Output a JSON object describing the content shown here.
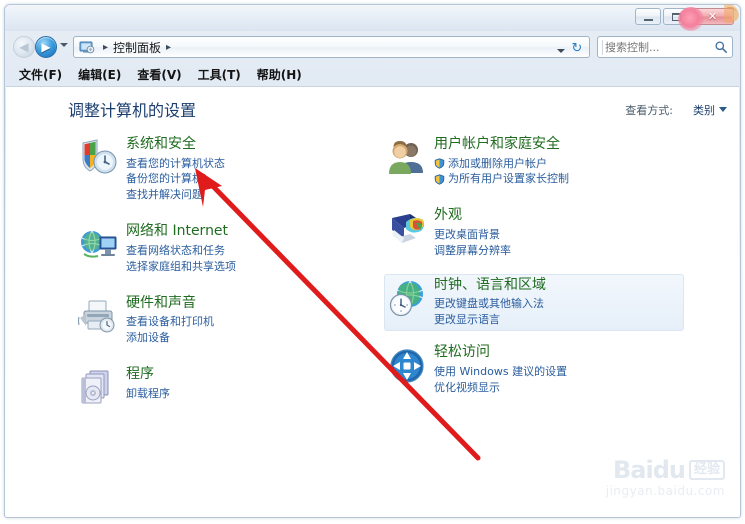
{
  "window": {
    "buttons": {
      "minimize": "–",
      "maximize": "□",
      "close": "✕"
    }
  },
  "addressbar": {
    "back_arrow": "◀",
    "forward_arrow": "▶",
    "breadcrumb_sep_1": "▸",
    "breadcrumb_root": "控制面板",
    "breadcrumb_sep_2": "▸",
    "refresh_glyph": "↻"
  },
  "search": {
    "placeholder": "搜索控制..."
  },
  "menubar": {
    "items": [
      {
        "label": "文件(F)"
      },
      {
        "label": "编辑(E)"
      },
      {
        "label": "查看(V)"
      },
      {
        "label": "工具(T)"
      },
      {
        "label": "帮助(H)"
      }
    ]
  },
  "page": {
    "title": "调整计算机的设置",
    "viewby_label": "查看方式:",
    "viewby_value": "类别"
  },
  "categories": {
    "left": [
      {
        "icon": "system-security-icon",
        "title": "系统和安全",
        "links": [
          {
            "text": "查看您的计算机状态",
            "shield": false
          },
          {
            "text": "备份您的计算机",
            "shield": false
          },
          {
            "text": "查找并解决问题",
            "shield": false
          }
        ]
      },
      {
        "icon": "network-internet-icon",
        "title": "网络和 Internet",
        "links": [
          {
            "text": "查看网络状态和任务",
            "shield": false
          },
          {
            "text": "选择家庭组和共享选项",
            "shield": false
          }
        ]
      },
      {
        "icon": "hardware-sound-icon",
        "title": "硬件和声音",
        "links": [
          {
            "text": "查看设备和打印机",
            "shield": false
          },
          {
            "text": "添加设备",
            "shield": false
          }
        ]
      },
      {
        "icon": "programs-icon",
        "title": "程序",
        "links": [
          {
            "text": "卸载程序",
            "shield": false
          }
        ]
      }
    ],
    "right": [
      {
        "icon": "user-accounts-icon",
        "title": "用户帐户和家庭安全",
        "links": [
          {
            "text": "添加或删除用户帐户",
            "shield": true
          },
          {
            "text": "为所有用户设置家长控制",
            "shield": true
          }
        ]
      },
      {
        "icon": "appearance-icon",
        "title": "外观",
        "links": [
          {
            "text": "更改桌面背景",
            "shield": false
          },
          {
            "text": "调整屏幕分辨率",
            "shield": false
          }
        ]
      },
      {
        "icon": "clock-language-region-icon",
        "title": "时钟、语言和区域",
        "hovered": true,
        "links": [
          {
            "text": "更改键盘或其他输入法",
            "shield": false
          },
          {
            "text": "更改显示语言",
            "shield": false
          }
        ]
      },
      {
        "icon": "ease-of-access-icon",
        "title": "轻松访问",
        "links": [
          {
            "text": "使用 Windows 建议的设置",
            "shield": false
          },
          {
            "text": "优化视频显示",
            "shield": false
          }
        ]
      }
    ]
  },
  "annotation": {
    "arrow_color": "#e01b1b"
  },
  "watermark": {
    "brand": "Baidu",
    "cn_label": "经验",
    "url": "jingyan.baidu.com"
  }
}
